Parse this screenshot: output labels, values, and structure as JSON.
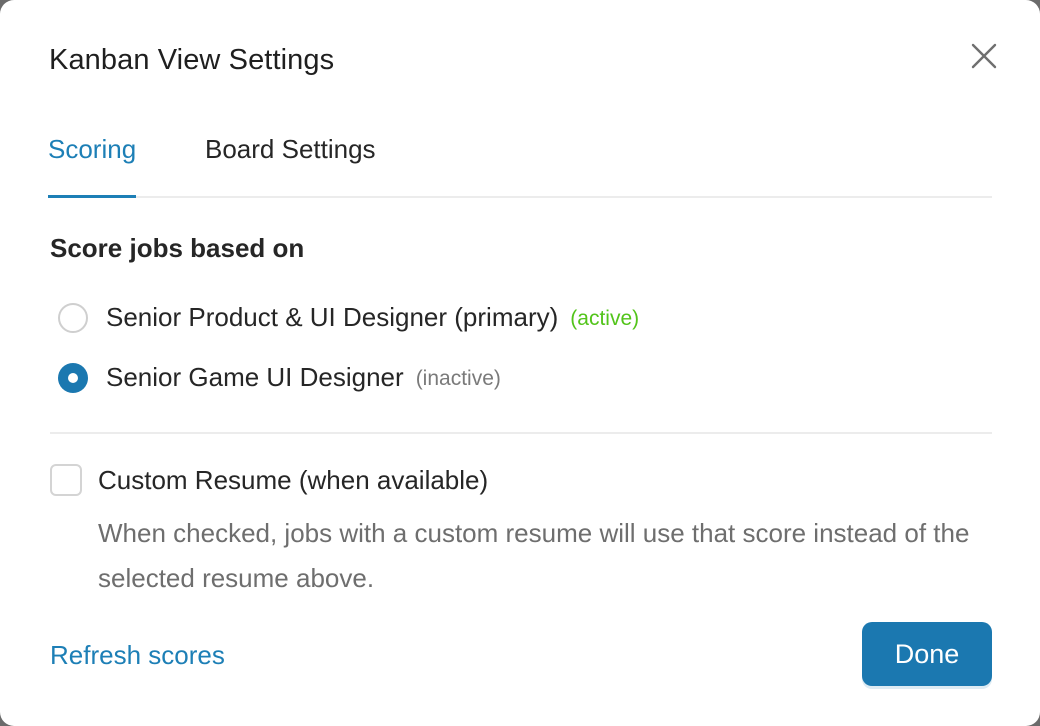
{
  "dialog": {
    "title": "Kanban View Settings",
    "close_icon": "close-icon"
  },
  "tabs": [
    {
      "label": "Scoring",
      "active": true
    },
    {
      "label": "Board Settings",
      "active": false
    }
  ],
  "scoring": {
    "section_title": "Score jobs based on",
    "options": [
      {
        "label": "Senior Product & UI Designer (primary)",
        "status": "(active)",
        "selected": false
      },
      {
        "label": "Senior Game UI Designer",
        "status": "(inactive)",
        "selected": true
      }
    ],
    "custom_resume": {
      "label": "Custom Resume (when available)",
      "checked": false,
      "help": "When checked, jobs with a custom resume will use that score instead of the selected resume above."
    }
  },
  "footer": {
    "refresh_label": "Refresh scores",
    "done_label": "Done"
  },
  "colors": {
    "accent": "#1b78b0",
    "active_status": "#52c41a",
    "inactive_status": "#7a7a7a"
  }
}
